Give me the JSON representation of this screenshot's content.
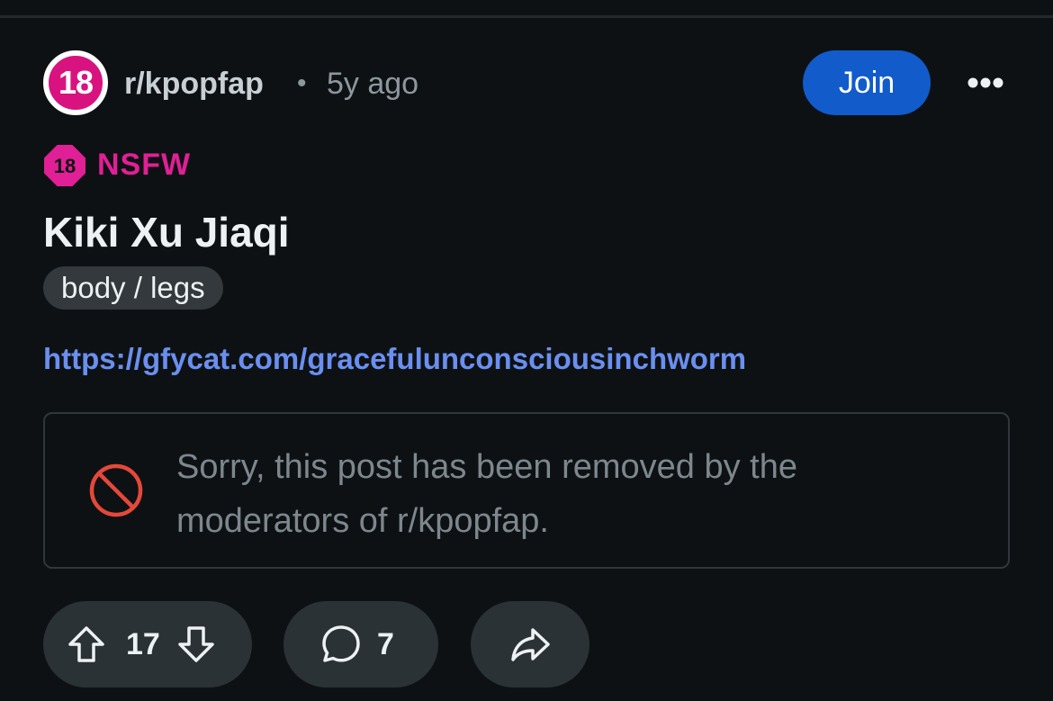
{
  "post": {
    "subreddit_avatar_text": "18",
    "subreddit": "r/kpopfap",
    "separator": "•",
    "age": "5y ago",
    "join_label": "Join",
    "nsfw_badge_text": "18",
    "nsfw_label": "NSFW",
    "title": "Kiki Xu Jiaqi",
    "flair": "body / legs",
    "link": "https://gfycat.com/gracefulunconsciousinchworm",
    "removed_message": "Sorry, this post has been removed by the moderators of r/kpopfap."
  },
  "actions": {
    "upvote_icon": "arrow-up-icon",
    "vote_count": "17",
    "downvote_icon": "arrow-down-icon",
    "comment_icon": "speech-bubble-icon",
    "comment_count": "7",
    "share_icon": "share-arrow-icon"
  },
  "colors": {
    "background": "#0e1113",
    "join_button": "#115bca",
    "nsfw": "#e11f96",
    "link": "#6a8ff0",
    "removed_icon": "#e5483b",
    "pill": "#2a3236"
  }
}
